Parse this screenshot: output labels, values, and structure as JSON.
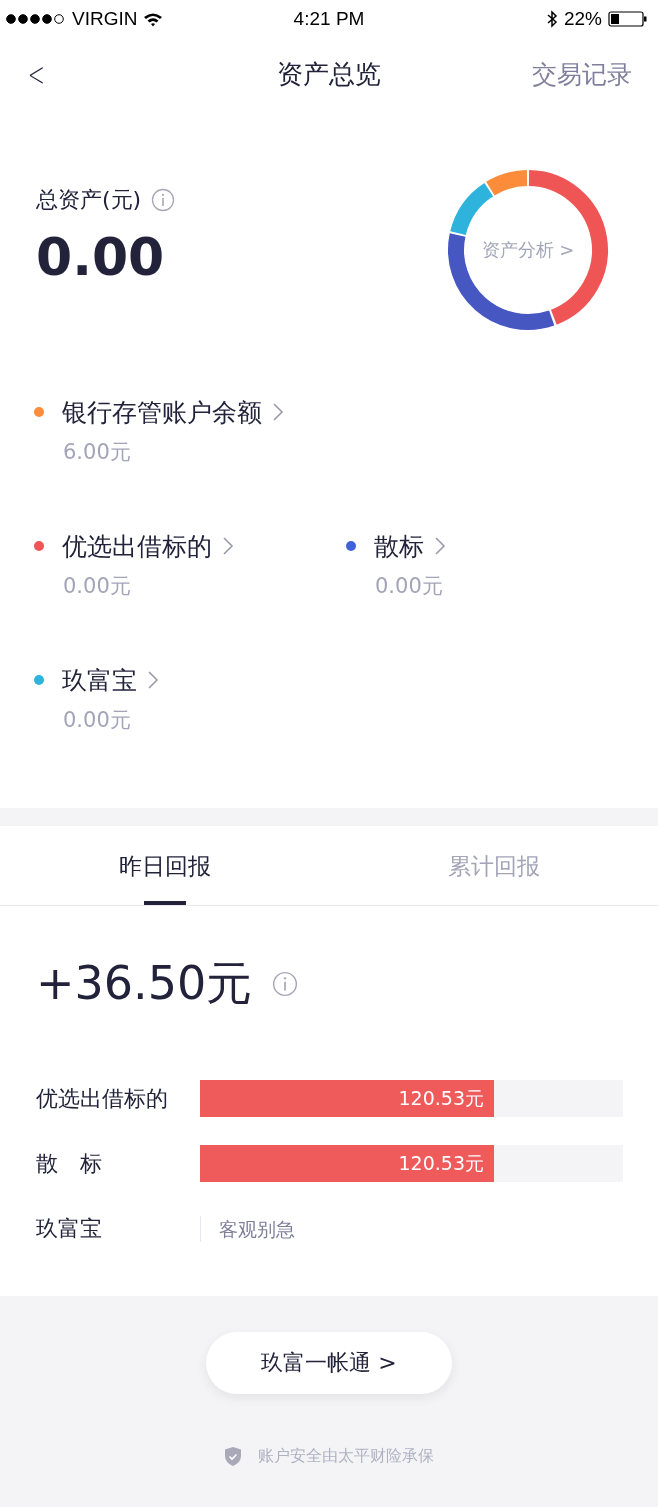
{
  "status_bar": {
    "carrier": "VIRGIN",
    "time": "4:21 PM",
    "battery": "22%"
  },
  "nav": {
    "back": "<",
    "title": "资产总览",
    "action": "交易记录"
  },
  "total": {
    "label": "总资产(元)",
    "amount": "0.00",
    "analysis_link": "资产分析 >"
  },
  "asset_rows": [
    [
      {
        "name": "银行存管账户余额",
        "value": "6.00元",
        "color": "#fc8c3a"
      }
    ],
    [
      {
        "name": "优选出借标的",
        "value": "0.00元",
        "color": "#ef5555"
      },
      {
        "name": "散标",
        "value": "0.00元",
        "color": "#3f62d8"
      }
    ],
    [
      {
        "name": "玖富宝",
        "value": "0.00元",
        "color": "#2eb4dc"
      }
    ]
  ],
  "tabs": [
    {
      "label": "昨日回报",
      "selected": true
    },
    {
      "label": "累计回报",
      "selected": false
    }
  ],
  "returns": {
    "amount": "+36.50元",
    "rows": [
      {
        "kind": "bar",
        "label": "优选出借标的",
        "value": "120.53元",
        "level": 0.695
      },
      {
        "kind": "bar",
        "label": "散　标",
        "value": "120.53元",
        "level": 0.695
      },
      {
        "kind": "note",
        "label": "玖富宝",
        "note": "客观别急"
      }
    ]
  },
  "footer": {
    "button": "玖富一帐通 >",
    "security_note": "账户安全由太平财险承保"
  }
}
